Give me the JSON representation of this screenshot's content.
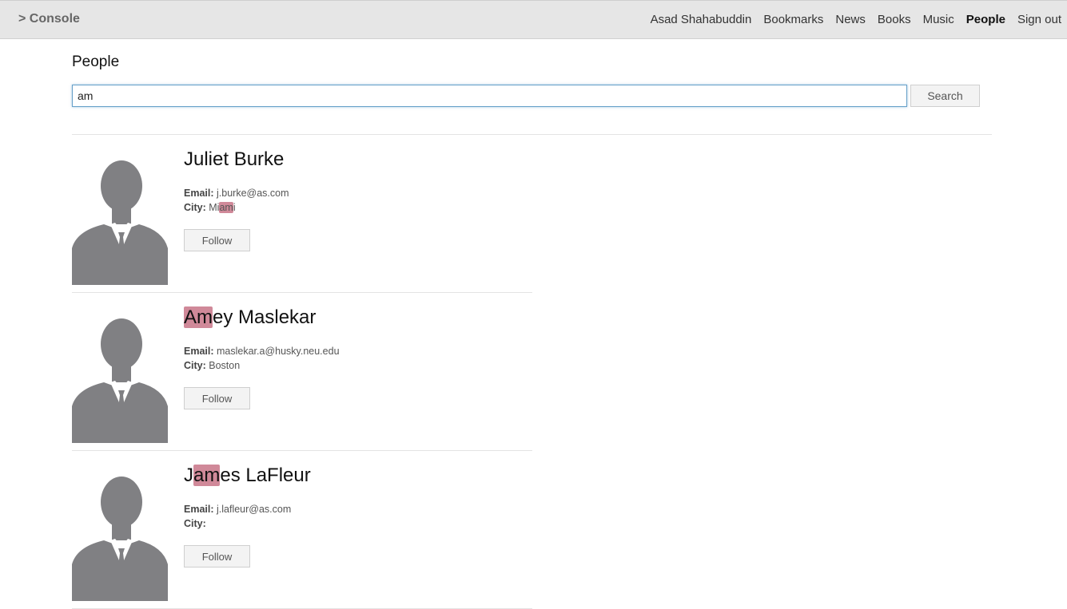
{
  "nav": {
    "brand": "> Console",
    "links": [
      "Asad Shahabuddin",
      "Bookmarks",
      "News",
      "Books",
      "Music",
      "People",
      "Sign out"
    ],
    "active": "People"
  },
  "page": {
    "title": "People"
  },
  "search": {
    "value": "am",
    "button_label": "Search"
  },
  "people": [
    {
      "name_parts": [
        "Juliet Burke",
        "",
        ""
      ],
      "email_label": "Email:",
      "email": "j.burke@as.com",
      "city_label": "City:",
      "city_parts": [
        "Mi",
        "am",
        "i"
      ],
      "follow_label": "Follow"
    },
    {
      "name_parts": [
        "",
        "Am",
        "ey Maslekar"
      ],
      "email_label": "Email:",
      "email": "maslekar.a@husky.neu.edu",
      "city_label": "City:",
      "city_parts": [
        "Boston",
        "",
        ""
      ],
      "follow_label": "Follow"
    },
    {
      "name_parts": [
        "J",
        "am",
        "es LaFleur"
      ],
      "email_label": "Email:",
      "email": "j.lafleur@as.com",
      "city_label": "City:",
      "city_parts": [
        "",
        "",
        ""
      ],
      "follow_label": "Follow"
    }
  ],
  "colors": {
    "navbar_bg": "#e6e6e6",
    "highlight": "#aa2846",
    "avatar": "#808083"
  }
}
